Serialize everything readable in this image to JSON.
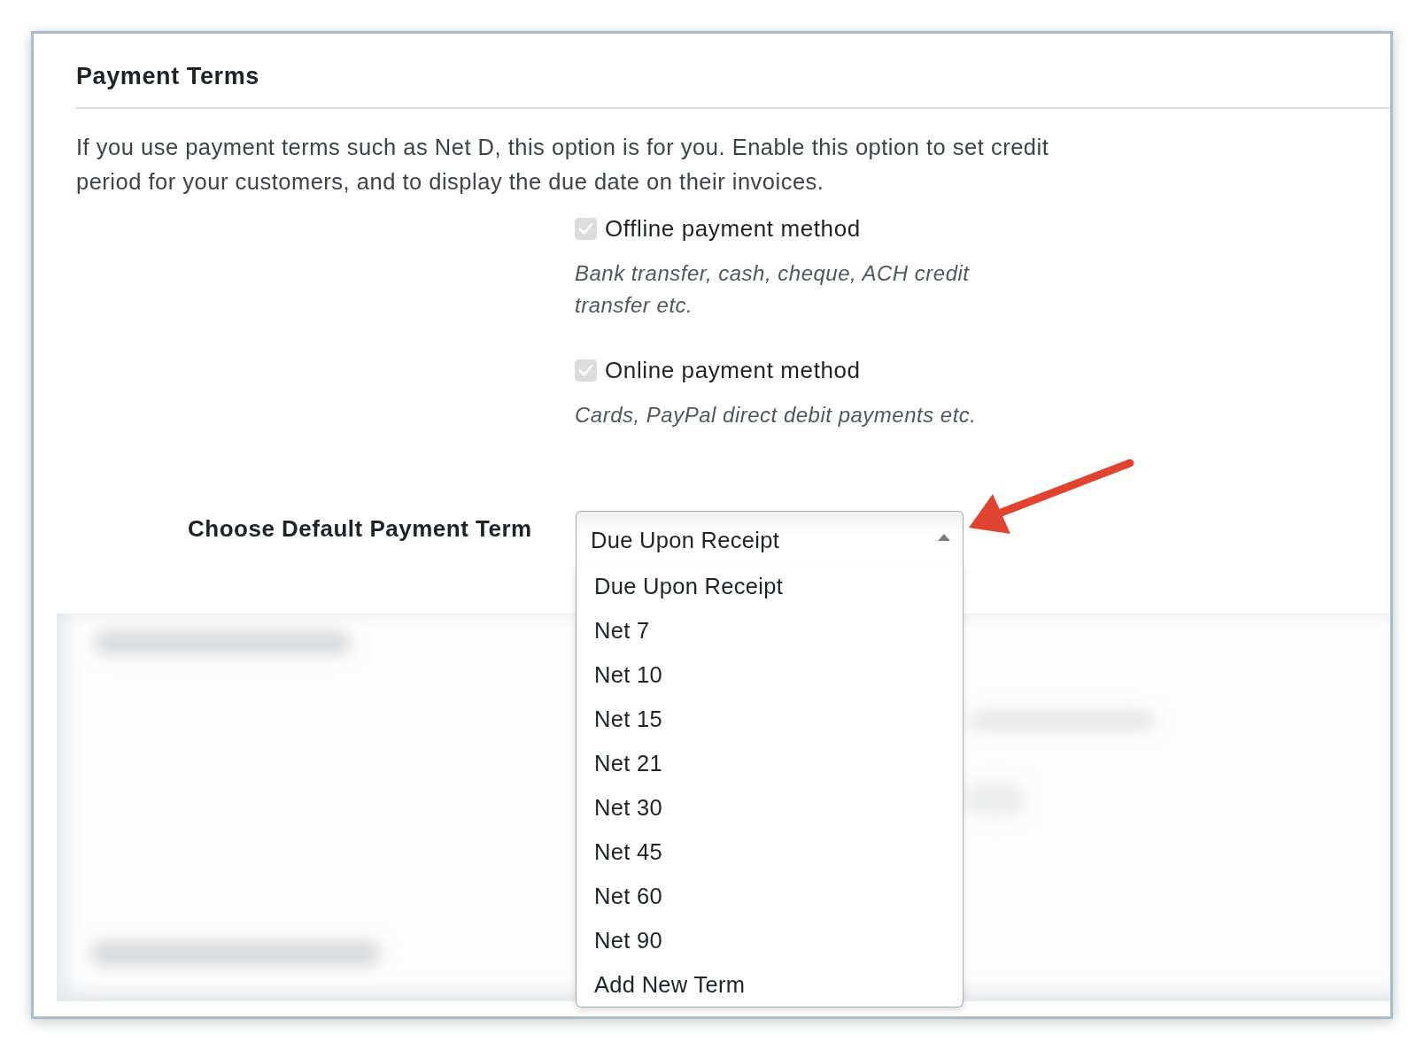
{
  "section": {
    "title": "Payment Terms",
    "description": "If you use payment terms such as Net D, this option is for you. Enable this option to set credit period for your customers, and to display the due date on their invoices."
  },
  "payment_methods": [
    {
      "label": "Offline payment method",
      "checked": true,
      "disabled": true,
      "hint": "Bank transfer, cash, cheque, ACH credit transfer etc."
    },
    {
      "label": "Online payment method",
      "checked": true,
      "disabled": true,
      "hint": "Cards, PayPal direct debit payments etc."
    }
  ],
  "default_term": {
    "label": "Choose Default Payment Term",
    "value": "Due Upon Receipt",
    "expanded": true,
    "options": [
      "Due Upon Receipt",
      "Net 7",
      "Net 10",
      "Net 15",
      "Net 21",
      "Net 30",
      "Net 45",
      "Net 60",
      "Net 90",
      "Add New Term"
    ]
  }
}
